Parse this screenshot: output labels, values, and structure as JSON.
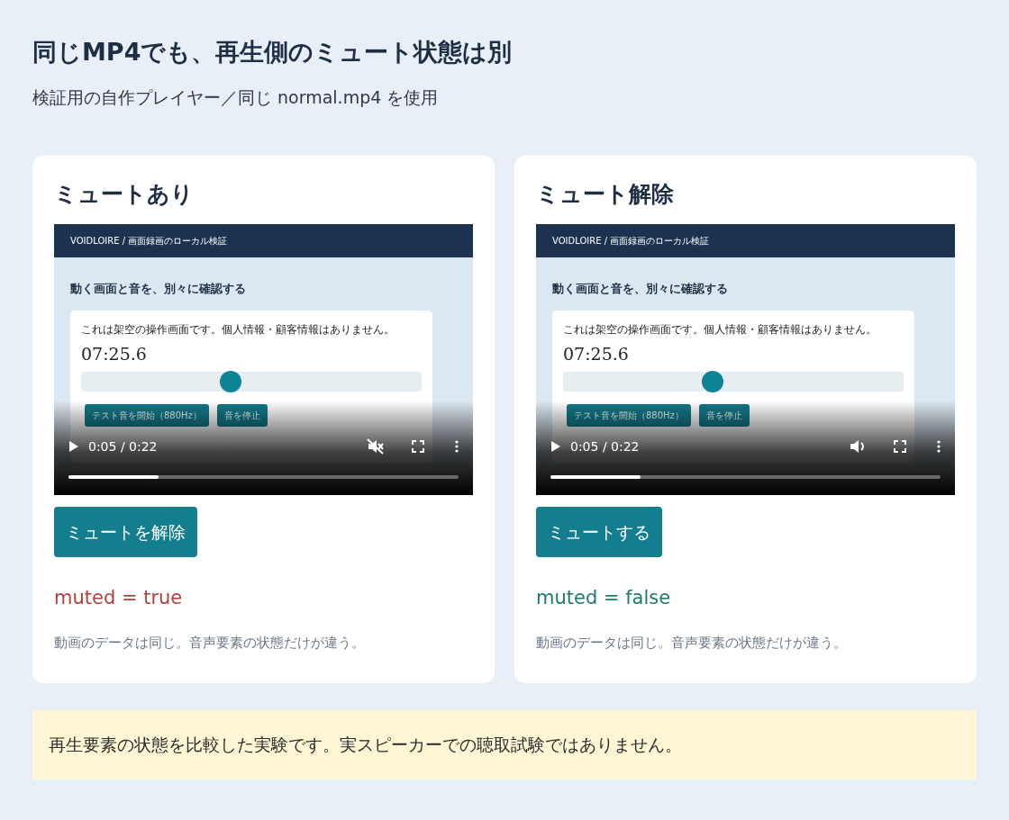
{
  "page": {
    "title": "同じMP4でも、再生側のミュート状態は別",
    "subtitle": "検証用の自作プレイヤー／同じ normal.mp4 を使用"
  },
  "panels": [
    {
      "title": "ミュートあり",
      "muted": true,
      "video": {
        "header": "VOIDLOIRE / 画面録画のローカル検証",
        "heading": "動く画面と音を、別々に確認する",
        "disclaimer": "これは架空の操作画面です。個人情報・顧客情報はありません。",
        "timer": "07:25.6",
        "slider": {
          "level": 0.44
        },
        "buttons": [
          "テスト音を開始（880Hz）",
          "音を停止"
        ],
        "time": "0:05 / 0:22",
        "progress": {
          "level": 0.23
        }
      },
      "button": "ミュートを解除",
      "state_text": "muted = true",
      "note": "動画のデータは同じ。音声要素の状態だけが違う。"
    },
    {
      "title": "ミュート解除",
      "muted": false,
      "video": {
        "header": "VOIDLOIRE / 画面録画のローカル検証",
        "heading": "動く画面と音を、別々に確認する",
        "disclaimer": "これは架空の操作画面です。個人情報・顧客情報はありません。",
        "timer": "07:25.6",
        "slider": {
          "level": 0.44
        },
        "buttons": [
          "テスト音を開始（880Hz）",
          "音を停止"
        ],
        "time": "0:05 / 0:22",
        "progress": {
          "level": 0.23
        }
      },
      "button": "ミュートする",
      "state_text": "muted = false",
      "note": "動画のデータは同じ。音声要素の状態だけが違う。"
    }
  ],
  "notice": "再生要素の状態を比較した実験です。実スピーカーでの聴取試験ではありません。"
}
